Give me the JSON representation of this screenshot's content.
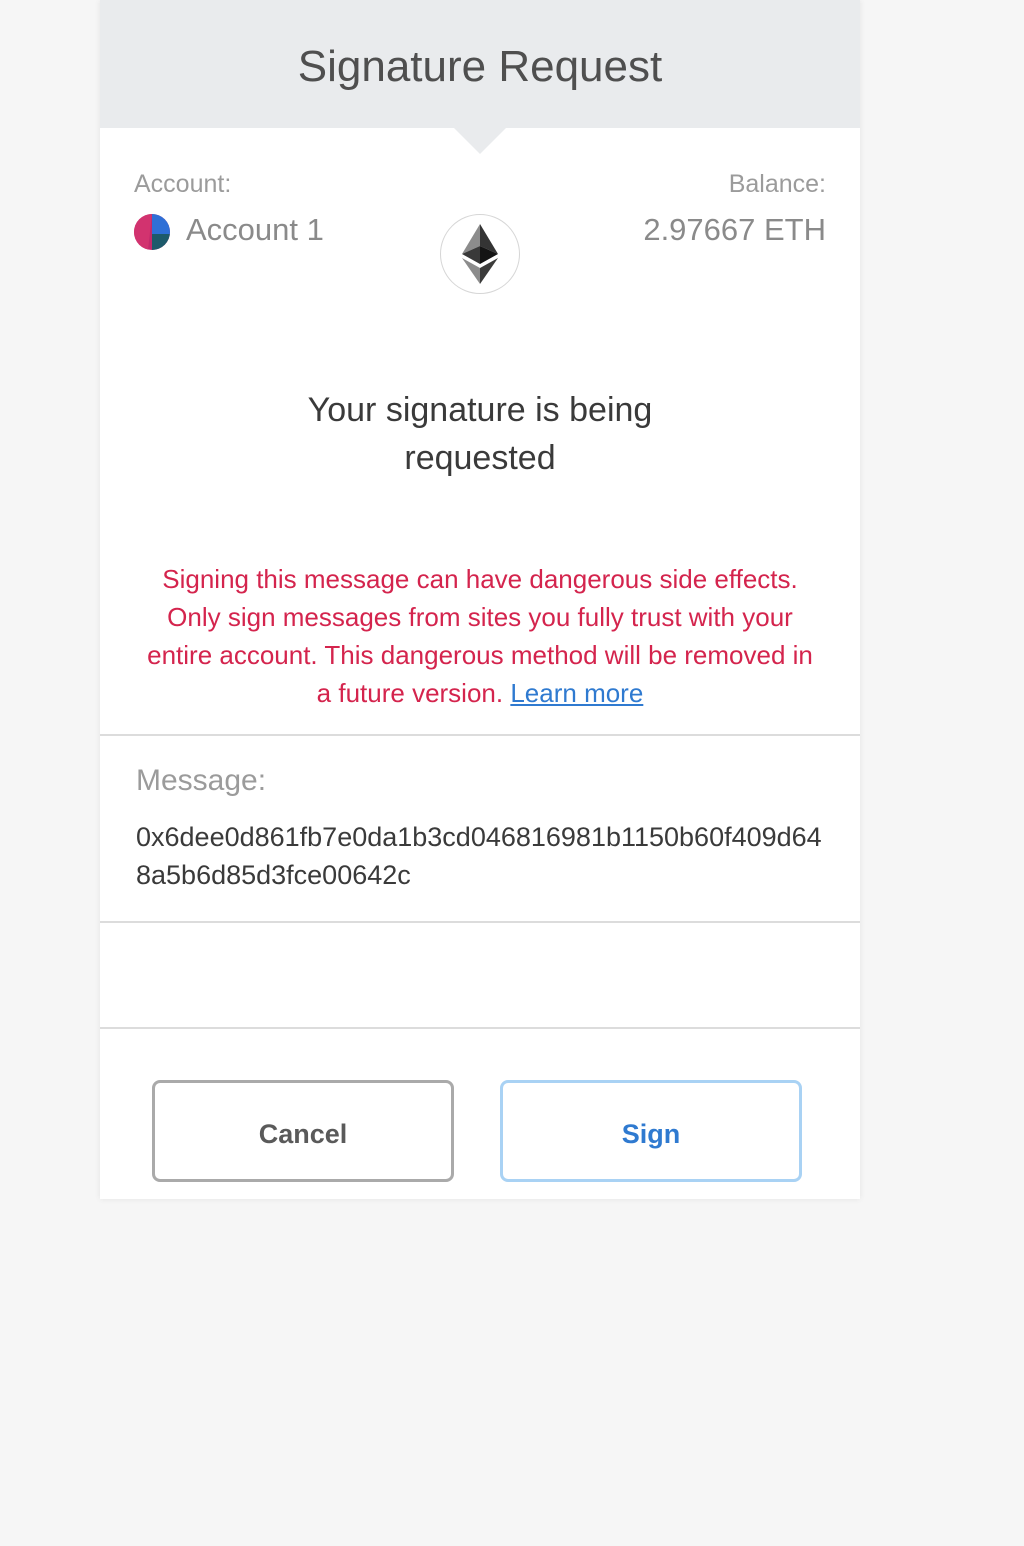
{
  "header": {
    "title": "Signature Request"
  },
  "account": {
    "label": "Account:",
    "name": "Account 1"
  },
  "balance": {
    "label": "Balance:",
    "value": "2.97667 ETH"
  },
  "network_icon": "ethereum-icon",
  "request": {
    "heading_line1": "Your signature is being",
    "heading_line2": "requested"
  },
  "warning": {
    "line1": "Signing this message can have dangerous side effects.",
    "line2": "Only sign messages from sites you fully trust with your",
    "line3": "entire account. This dangerous method will be removed in",
    "line4": "a future version.",
    "link": "Learn more",
    "color": "#d4244d"
  },
  "message": {
    "label": "Message:",
    "value": "0x6dee0d861fb7e0da1b3cd046816981b1150b60f409d648a5b6d85d3fce00642c"
  },
  "buttons": {
    "cancel": "Cancel",
    "sign": "Sign"
  },
  "colors": {
    "accent": "#2f7ad0",
    "header_bg": "#e9ebed"
  }
}
